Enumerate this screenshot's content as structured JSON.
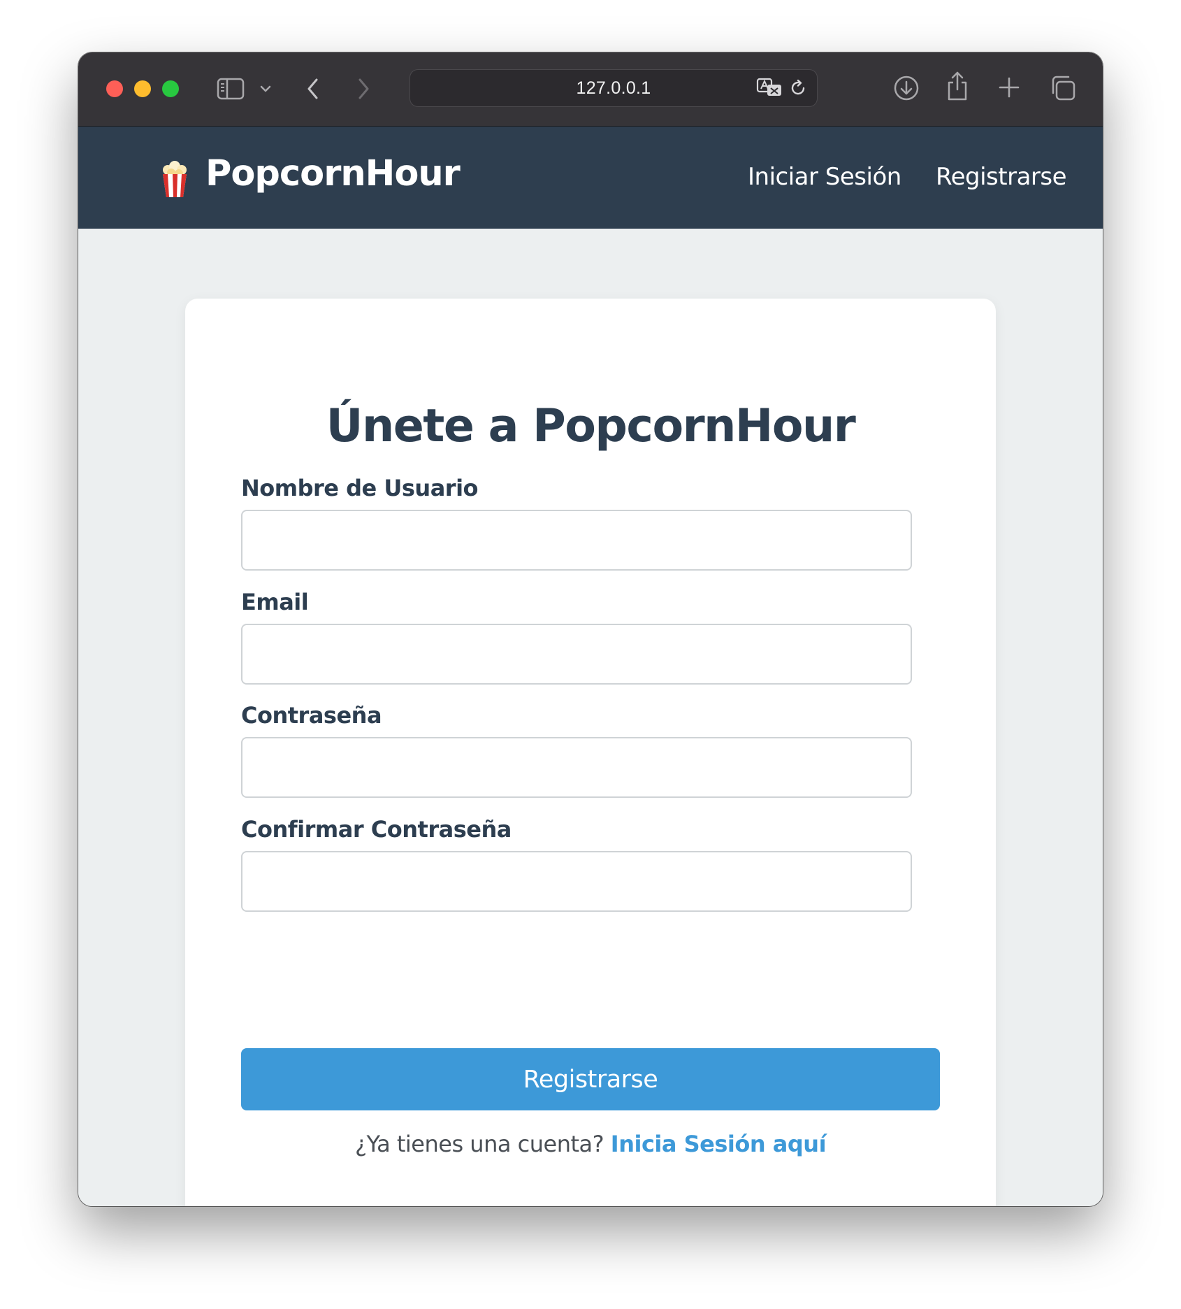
{
  "browser": {
    "url": "127.0.0.1",
    "icons": [
      "sidebar-icon",
      "chevron-down-icon",
      "back-arrow-icon",
      "forward-arrow-icon",
      "translate-icon",
      "reload-icon",
      "download-icon",
      "share-icon",
      "new-tab-icon",
      "tab-overview-icon"
    ]
  },
  "nav": {
    "logo_icon": "popcorn-icon",
    "brand": "PopcornHour",
    "links": [
      {
        "label": "Iniciar Sesión"
      },
      {
        "label": "Registrarse"
      }
    ]
  },
  "form": {
    "title": "Únete a PopcornHour",
    "fields": [
      {
        "label": "Nombre de Usuario",
        "value": ""
      },
      {
        "label": "Email",
        "value": ""
      },
      {
        "label": "Contraseña",
        "value": ""
      },
      {
        "label": "Confirmar Contraseña",
        "value": ""
      }
    ],
    "submit_label": "Registrarse",
    "footer_text": "¿Ya tienes una cuenta? ",
    "footer_link": "Inicia Sesión aquí"
  },
  "colors": {
    "nav_bg": "#2e3e4f",
    "accent": "#3d99d8",
    "page_bg": "#eceff0",
    "heading": "#2d3e50"
  }
}
